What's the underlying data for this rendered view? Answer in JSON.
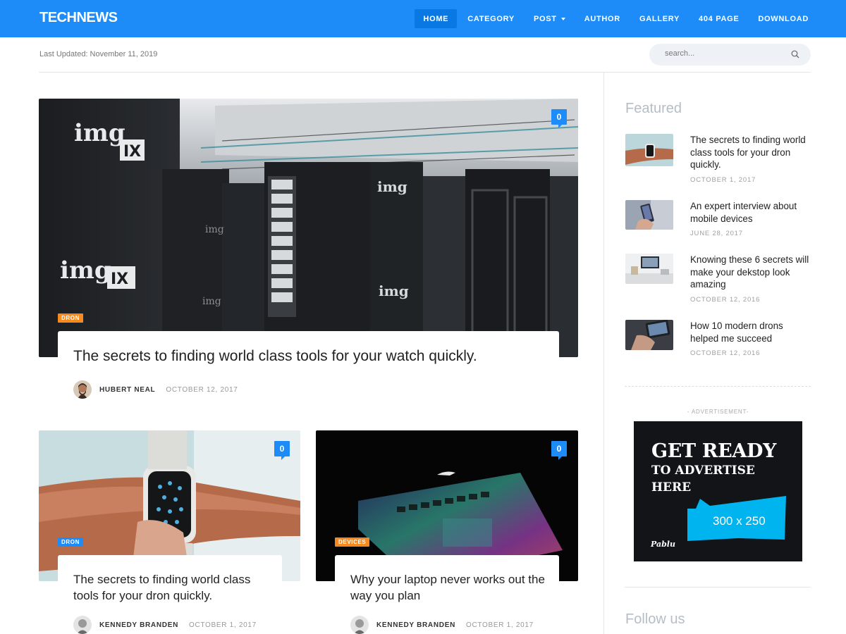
{
  "header": {
    "logo": "TECHNEWS",
    "nav": [
      {
        "label": "HOME",
        "active": true
      },
      {
        "label": "CATEGORY"
      },
      {
        "label": "POST",
        "dropdown": true
      },
      {
        "label": "AUTHOR"
      },
      {
        "label": "GALLERY"
      },
      {
        "label": "404 PAGE"
      },
      {
        "label": "DOWNLOAD"
      }
    ]
  },
  "subbar": {
    "last_updated": "Last Updated: November 11, 2019",
    "search_placeholder": "search..."
  },
  "hero": {
    "tag": "DRON",
    "comments": "0",
    "title": "The secrets to finding world class tools for your watch quickly.",
    "author": "HUBERT NEAL",
    "date": "OCTOBER 12, 2017"
  },
  "cards": [
    {
      "tag": "DRON",
      "comments": "0",
      "title": "The secrets to finding world class tools for your dron quickly.",
      "author": "KENNEDY BRANDEN",
      "date": "OCTOBER 1, 2017"
    },
    {
      "tag": "DEVICES",
      "comments": "0",
      "title": "Why your laptop never works out the way you plan",
      "author": "KENNEDY BRANDEN",
      "date": "OCTOBER 1, 2017"
    }
  ],
  "sidebar": {
    "featured_title": "Featured",
    "featured": [
      {
        "title": "The secrets to finding world class tools for your dron quickly.",
        "date": "OCTOBER 1, 2017"
      },
      {
        "title": "An expert interview about mobile devices",
        "date": "JUNE 28, 2017"
      },
      {
        "title": "Knowing these 6 secrets will make your dekstop look amazing",
        "date": "OCTOBER 12, 2016"
      },
      {
        "title": "How 10 modern drons helped me succeed",
        "date": "OCTOBER 12, 2016"
      }
    ],
    "ad_label": "- ADVERTISEMENT-",
    "ad": {
      "line1": "GET READY",
      "line2": "TO ADVERTISE",
      "line3": "HERE",
      "size": "300 x 250",
      "brand": "Pablu"
    },
    "follow_title": "Follow us"
  },
  "colors": {
    "primary": "#1e8cf8",
    "tag_orange": "#f68a1e",
    "ad_banner": "#00b4f0"
  }
}
